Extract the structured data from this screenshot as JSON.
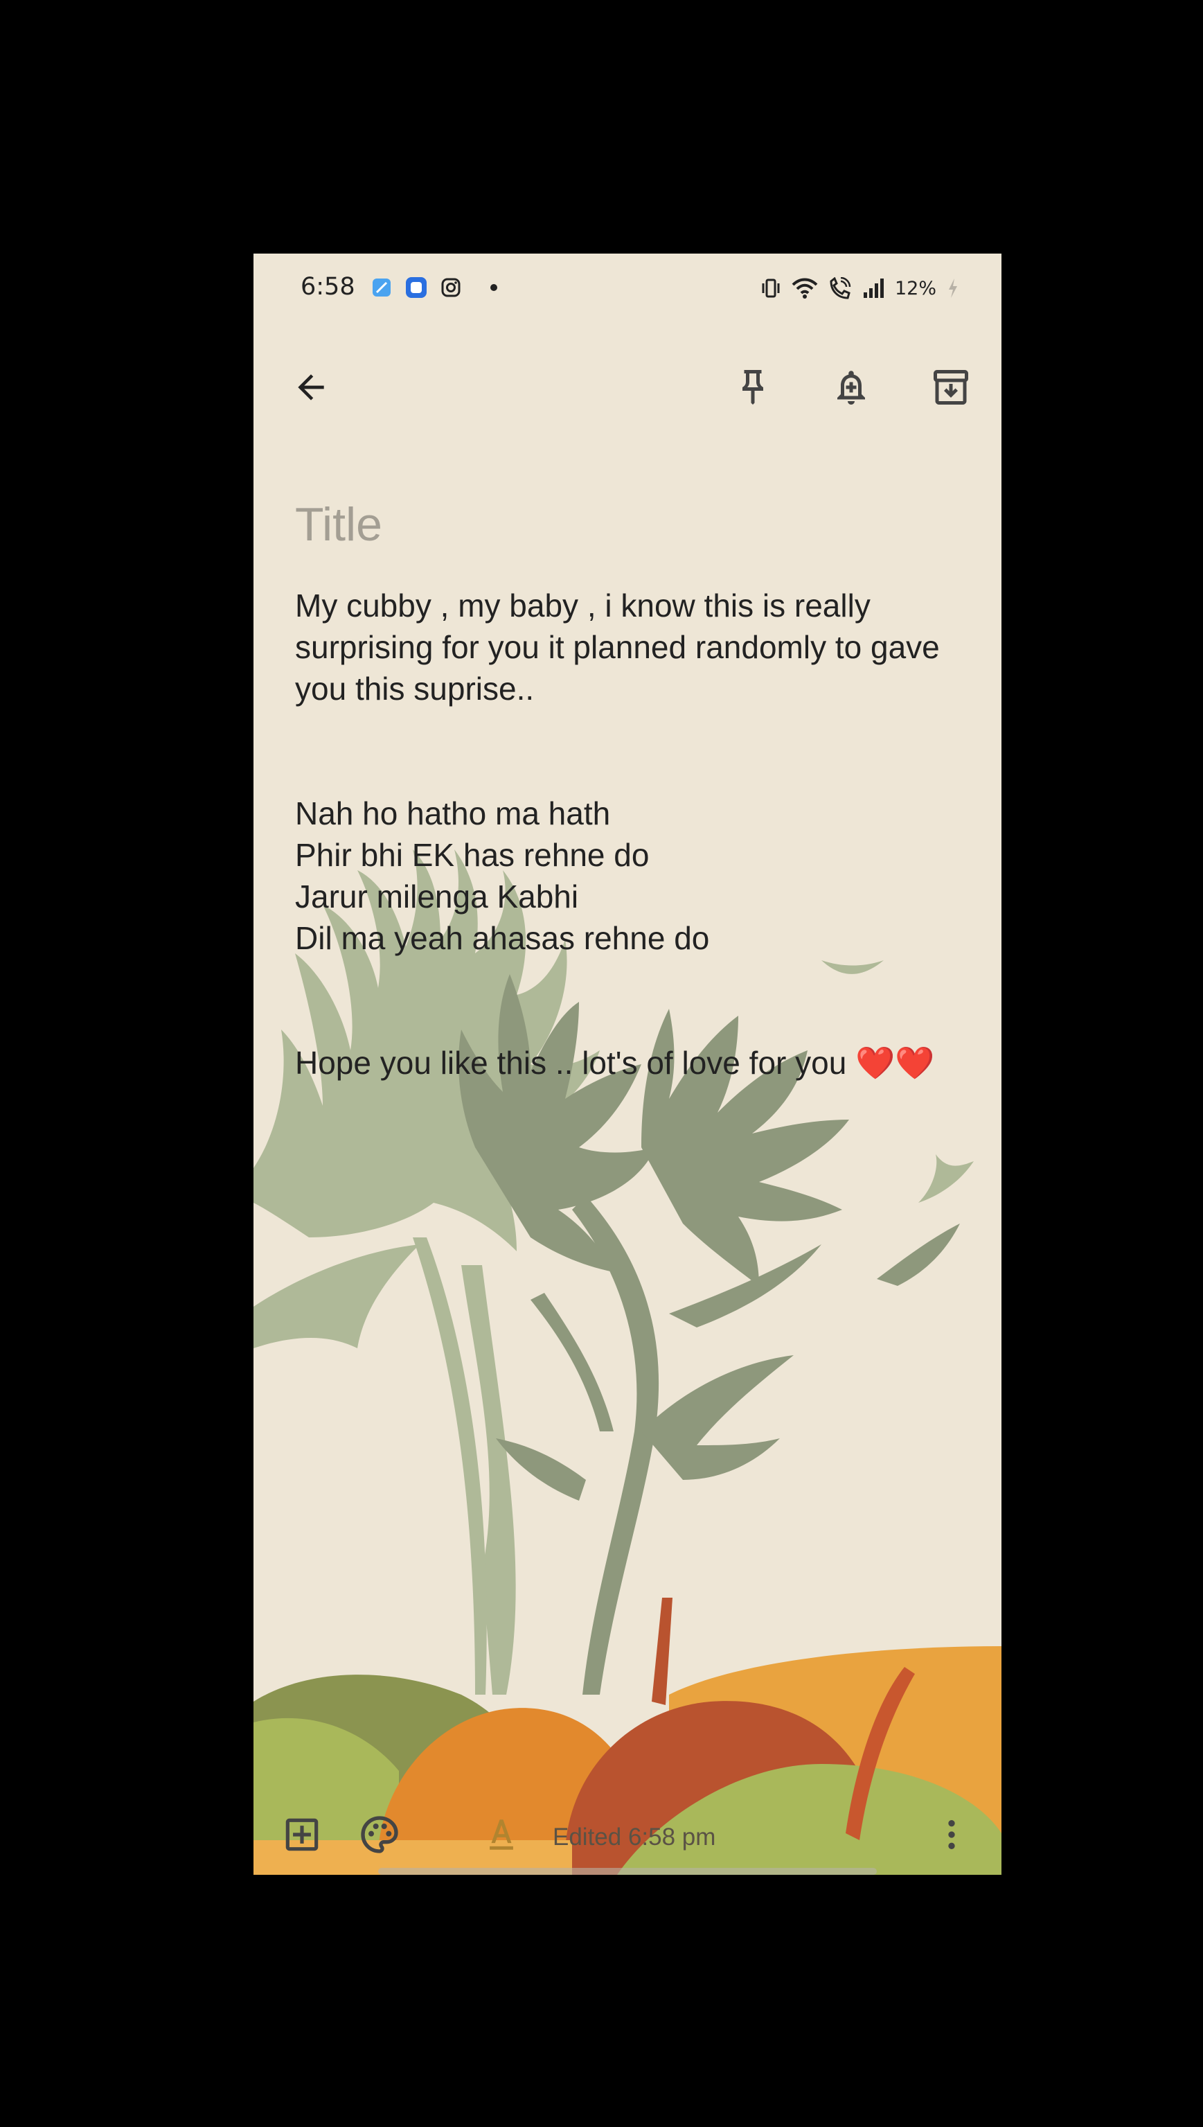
{
  "status_bar": {
    "time": "6:58",
    "battery": "12%",
    "notification_icons": [
      "app-icon",
      "messages-icon",
      "instagram-icon",
      "more-dot-icon"
    ],
    "system_icons": [
      "vibrate-icon",
      "wifi-icon",
      "wifi-calling-icon",
      "signal-icon",
      "battery-charging-icon"
    ]
  },
  "toolbar": {
    "back_icon": "arrow-back-icon",
    "pin_icon": "pin-icon",
    "reminder_icon": "bell-plus-icon",
    "archive_icon": "archive-icon"
  },
  "note": {
    "title_placeholder": "Title",
    "lines": [
      "My cubby , my baby , i know this is really",
      "surprising for you it planned randomly to gave",
      "you this suprise..",
      "",
      "",
      "Nah ho hatho ma hath",
      "Phir bhi EK has rehne do",
      "Jarur milenga Kabhi",
      "Dil ma yeah ahasas rehne do",
      "",
      "",
      "Hope you like this .. lot's of love for you ",
      "❤️❤️"
    ]
  },
  "bottom_bar": {
    "add_icon": "add-box-icon",
    "palette_icon": "palette-icon",
    "text_format_icon": "text-format-icon",
    "edited": "Edited 6:58 pm",
    "more_icon": "more-vert-icon"
  },
  "colors": {
    "background": "#eee6d6",
    "text": "#222222",
    "placeholder": "#a39e93",
    "leaf_light": "#afb998",
    "leaf_dark": "#8e987c",
    "orange": "#e2892d",
    "red_fruit": "#b9532f",
    "green_fruit": "#a9b85a"
  }
}
